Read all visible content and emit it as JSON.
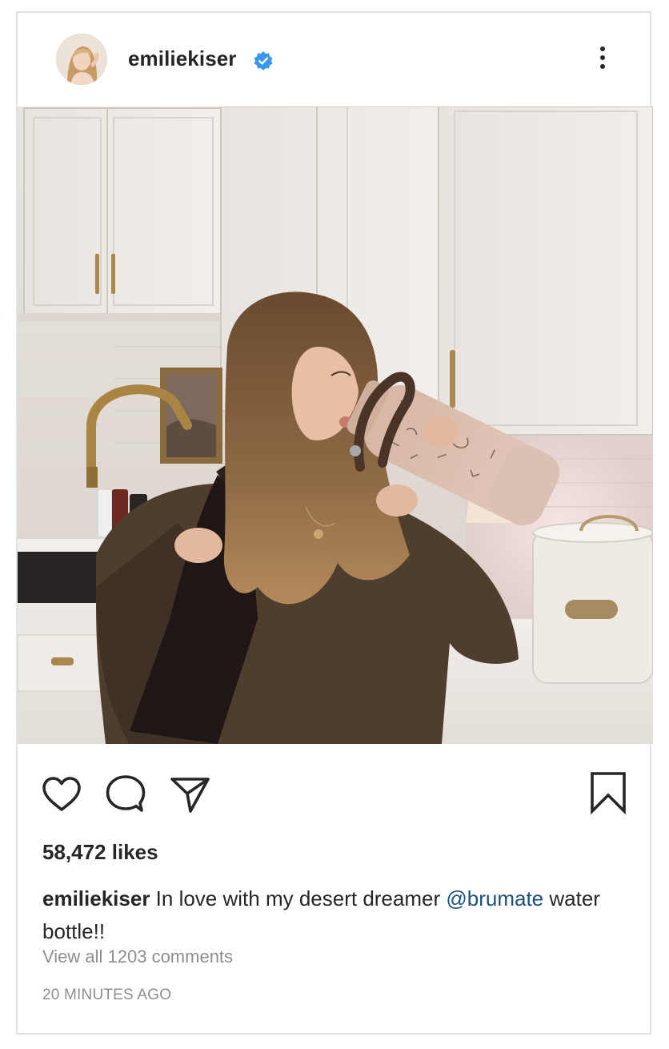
{
  "post": {
    "username": "emiliekiser",
    "verified": true,
    "more_icon": "more-vertical-icon",
    "likes_text": "58,472 likes",
    "caption": {
      "username": "emiliekiser",
      "text_before": " In love with my desert dreamer ",
      "mention": "@brumate",
      "text_after": " water bottle!!"
    },
    "comments_link": "View all 1203 comments",
    "timestamp": "20 MINUTES AGO",
    "actions": [
      "heart-icon",
      "comment-icon",
      "share-icon",
      "bookmark-icon"
    ]
  },
  "colors": {
    "text": "#262626",
    "muted": "#8e8e8e",
    "link": "#1d4f7a",
    "verified": "#3897f0",
    "border": "#e2e2e2"
  }
}
